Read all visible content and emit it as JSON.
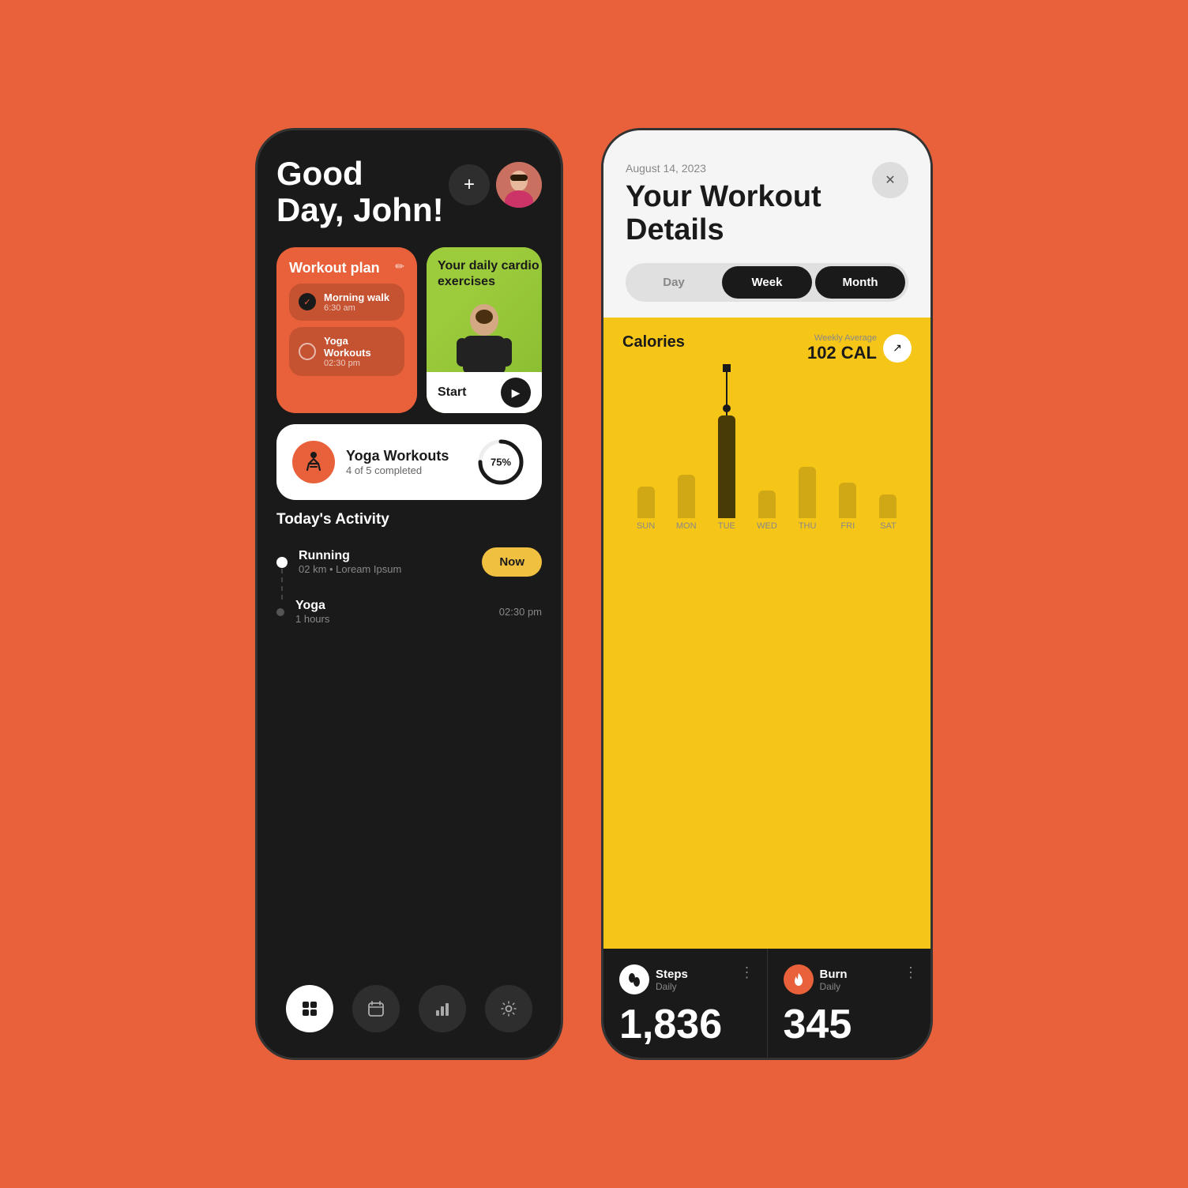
{
  "background": "#E8613A",
  "left_phone": {
    "greeting": "Good\nDay, John!",
    "add_button_label": "+",
    "workout_card": {
      "title": "Workout plan",
      "items": [
        {
          "name": "Morning walk",
          "time": "6:30 am",
          "checked": true
        },
        {
          "name": "Yoga Workouts",
          "time": "02:30 pm",
          "checked": false
        }
      ]
    },
    "cardio_card": {
      "title": "Your daily cardio exercises",
      "start_label": "Start"
    },
    "progress_card": {
      "title": "Yoga Workouts",
      "subtitle": "4 of 5 completed",
      "percent": 75,
      "percent_label": "75%"
    },
    "activity_section": {
      "title": "Today's Activity",
      "items": [
        {
          "name": "Running",
          "detail": "02 km • Loream Ipsum",
          "time": "Now",
          "has_now": true
        },
        {
          "name": "Yoga",
          "detail": "1 hours",
          "time": "02:30 pm",
          "has_now": false
        }
      ]
    },
    "nav": [
      {
        "icon": "grid",
        "active": true
      },
      {
        "icon": "calendar",
        "active": false
      },
      {
        "icon": "chart",
        "active": false
      },
      {
        "icon": "settings",
        "active": false
      }
    ]
  },
  "right_phone": {
    "date": "August 14, 2023",
    "heading": "Your Workout\nDetails",
    "close_label": "×",
    "tabs": [
      {
        "label": "Day",
        "active": false
      },
      {
        "label": "Week",
        "active": true
      },
      {
        "label": "Month",
        "active": true
      }
    ],
    "calories": {
      "label": "Calories",
      "avg_label": "Weekly Average",
      "avg_value": "102 CAL",
      "days": [
        "SUN",
        "MON",
        "TUE",
        "WED",
        "THU",
        "FRI",
        "SAT"
      ],
      "bars": [
        40,
        55,
        130,
        35,
        65,
        45,
        30
      ],
      "highlighted_index": 2
    },
    "stats": [
      {
        "icon": "footprint",
        "title": "Steps",
        "subtitle": "Daily",
        "value": "1,836"
      },
      {
        "icon": "flame",
        "title": "Burn",
        "subtitle": "Daily",
        "value": "345"
      }
    ]
  }
}
